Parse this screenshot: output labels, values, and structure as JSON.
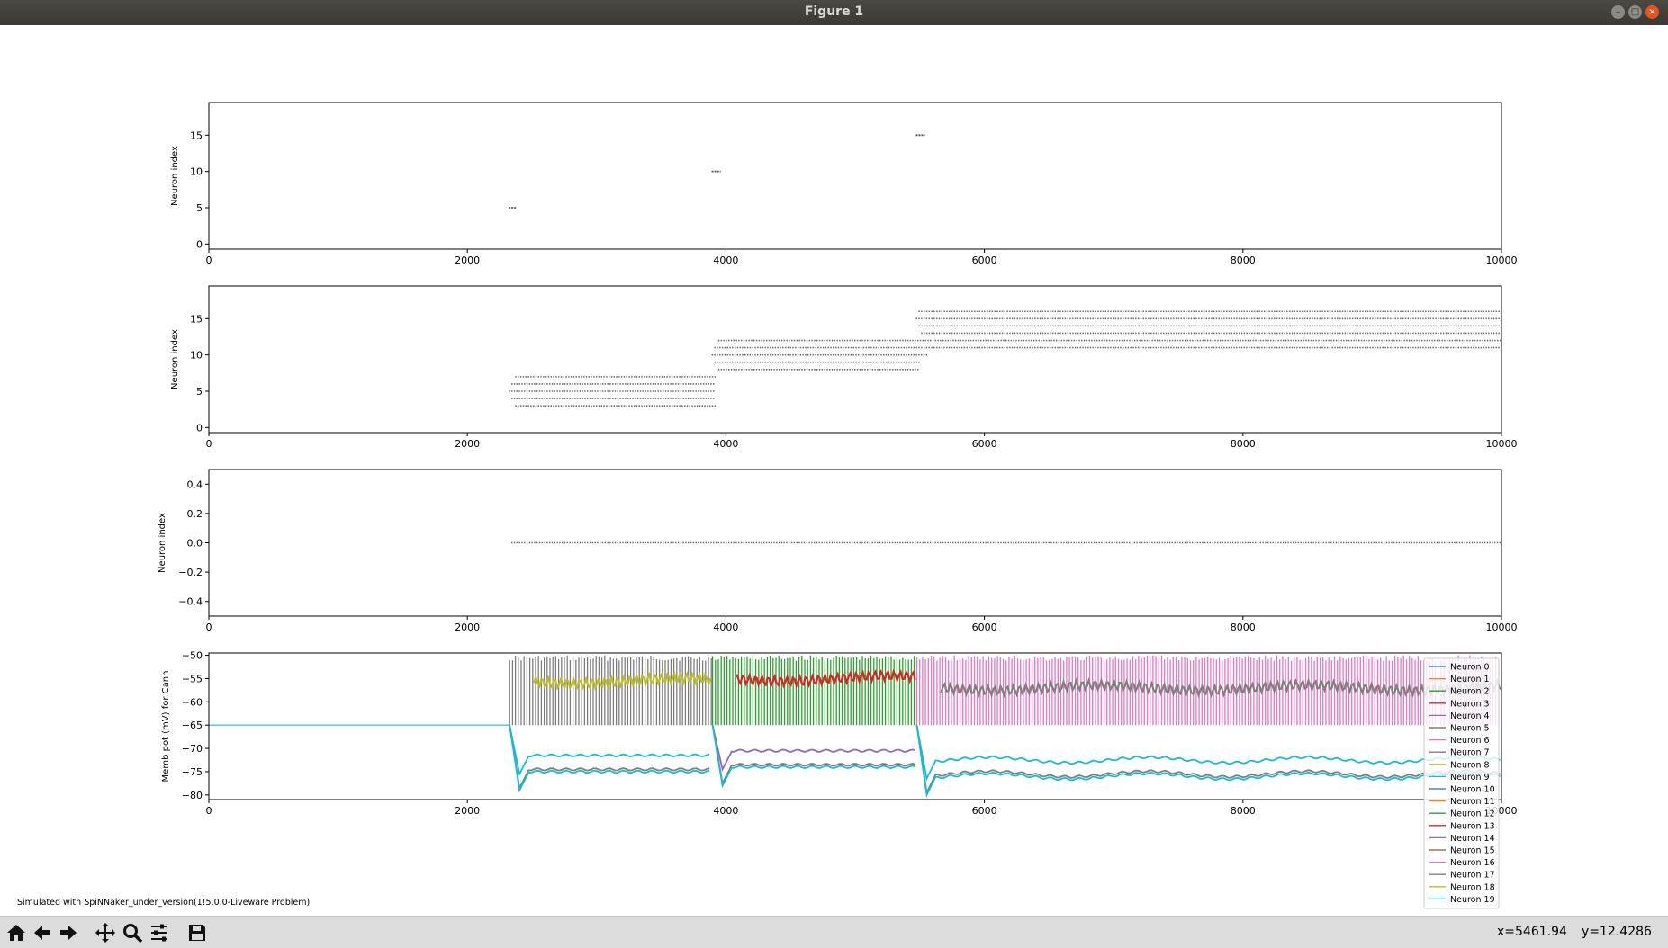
{
  "window": {
    "title": "Figure 1"
  },
  "footer": {
    "note": "Simulated with SpiNNaker_under_version(1!5.0.0-Liveware Problem)"
  },
  "status": {
    "x_readout": "x=5461.94",
    "y_readout": "y=12.4286"
  },
  "toolbar": {
    "icons": [
      "home-icon",
      "back-arrow-icon",
      "forward-arrow-icon",
      "pan-icon",
      "zoom-icon",
      "configure-subplots-icon",
      "save-icon"
    ]
  },
  "colors": {
    "spike": "#555555",
    "tab10": [
      "#1f77b4",
      "#ff7f0e",
      "#2ca02c",
      "#d62728",
      "#9467bd",
      "#8c564b",
      "#e377c2",
      "#7f7f7f",
      "#bcbd22",
      "#17becf"
    ]
  },
  "chart_data": [
    {
      "type": "scatter",
      "ylabel": "Neuron index",
      "xlim": [
        0,
        10000
      ],
      "ylim": [
        -0.7,
        19.5
      ],
      "xticks": [
        0,
        2000,
        4000,
        6000,
        8000,
        10000
      ],
      "yticks": [
        0,
        5,
        10,
        15
      ],
      "spike_bursts": [
        {
          "neuron": 5,
          "t_start": 2320,
          "t_end": 2380
        },
        {
          "neuron": 10,
          "t_start": 3890,
          "t_end": 3960
        },
        {
          "neuron": 15,
          "t_start": 5470,
          "t_end": 5540
        }
      ]
    },
    {
      "type": "scatter",
      "ylabel": "Neuron index",
      "xlim": [
        0,
        10000
      ],
      "ylim": [
        -0.7,
        19.5
      ],
      "xticks": [
        0,
        2000,
        4000,
        6000,
        8000,
        10000
      ],
      "yticks": [
        0,
        5,
        10,
        15
      ],
      "spike_trains": [
        {
          "neuron": 3,
          "t_start": 2370,
          "t_end": 3920
        },
        {
          "neuron": 4,
          "t_start": 2340,
          "t_end": 3920
        },
        {
          "neuron": 5,
          "t_start": 2320,
          "t_end": 3920
        },
        {
          "neuron": 6,
          "t_start": 2340,
          "t_end": 3920
        },
        {
          "neuron": 7,
          "t_start": 2370,
          "t_end": 3920
        },
        {
          "neuron": 8,
          "t_start": 3940,
          "t_end": 5500
        },
        {
          "neuron": 9,
          "t_start": 3910,
          "t_end": 5500
        },
        {
          "neuron": 10,
          "t_start": 3890,
          "t_end": 5560
        },
        {
          "neuron": 11,
          "t_start": 3910,
          "t_end": 10000
        },
        {
          "neuron": 12,
          "t_start": 3940,
          "t_end": 10000
        },
        {
          "neuron": 13,
          "t_start": 5510,
          "t_end": 10000
        },
        {
          "neuron": 14,
          "t_start": 5490,
          "t_end": 10000
        },
        {
          "neuron": 15,
          "t_start": 5470,
          "t_end": 10000
        },
        {
          "neuron": 16,
          "t_start": 5490,
          "t_end": 10000
        }
      ]
    },
    {
      "type": "scatter",
      "ylabel": "Neuron index",
      "xlim": [
        0,
        10000
      ],
      "ylim": [
        -0.5,
        0.5
      ],
      "xticks": [
        0,
        2000,
        4000,
        6000,
        8000,
        10000
      ],
      "yticks": [
        -0.4,
        -0.2,
        0.0,
        0.2,
        0.4
      ],
      "ytick_labels": [
        "−0.4",
        "−0.2",
        "0.0",
        "0.2",
        "0.4"
      ],
      "spike_trains": [
        {
          "neuron": 0,
          "t_start": 2340,
          "t_end": 10000
        }
      ]
    },
    {
      "type": "line",
      "ylabel": "Memb pot (mV) for Cann",
      "xlim": [
        0,
        10000
      ],
      "ylim": [
        -81,
        -49.5
      ],
      "xticks": [
        0,
        2000,
        4000,
        6000,
        8000,
        10000
      ],
      "yticks": [
        -50,
        -55,
        -60,
        -65,
        -70,
        -75,
        -80
      ],
      "ytick_labels": [
        "−50",
        "−55",
        "−60",
        "−65",
        "−70",
        "−75",
        "−80"
      ],
      "resting_potential": -65,
      "spike_threshold": -50,
      "legend": {
        "placement": "lower-right",
        "entries": [
          "Neuron 0",
          "Neuron 1",
          "Neuron 2",
          "Neuron 3",
          "Neuron 4",
          "Neuron 5",
          "Neuron 6",
          "Neuron 7",
          "Neuron 8",
          "Neuron 9",
          "Neuron 10",
          "Neuron 11",
          "Neuron 12",
          "Neuron 13",
          "Neuron 14",
          "Neuron 15",
          "Neuron 16",
          "Neuron 17",
          "Neuron 18",
          "Neuron 19"
        ]
      },
      "phases": [
        {
          "t_start": 2320,
          "t_end": 3890,
          "spiking_color_index": 7,
          "plateau": -55.5,
          "plateau_color_index": 8,
          "inhibited": [
            -71.5,
            -74.5,
            -75
          ]
        },
        {
          "t_start": 3890,
          "t_end": 5470,
          "spiking_color_index": 2,
          "plateau": -55,
          "plateau_color_index": 3,
          "inhibited": [
            -70.5,
            -73.5,
            -74
          ]
        },
        {
          "t_start": 5470,
          "t_end": 10000,
          "spiking_color_index": 6,
          "plateau": -57,
          "plateau_color_index": 7,
          "inhibited": [
            -72.5,
            -75.5,
            -76
          ]
        }
      ]
    }
  ]
}
